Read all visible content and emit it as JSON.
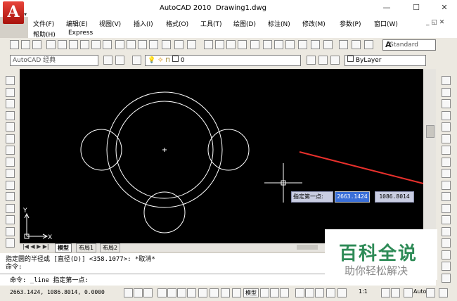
{
  "window": {
    "app_name": "AutoCAD 2010",
    "doc_name": "Drawing1.dwg",
    "logo_letter": "A",
    "controls": [
      "—",
      "☐",
      "✕"
    ],
    "mdi_controls": "_ ◱ ✕"
  },
  "menus": [
    "文件(F)",
    "编辑(E)",
    "视图(V)",
    "插入(I)",
    "格式(O)",
    "工具(T)",
    "绘图(D)",
    "标注(N)",
    "修改(M)",
    "参数(P)",
    "窗口(W)"
  ],
  "menus2": [
    "帮助(H)",
    "Express"
  ],
  "toolbar": {
    "workspace": "AutoCAD 经典",
    "layer_value": "0",
    "text_style": "Standard",
    "color_value": "ByLayer"
  },
  "canvas": {
    "tooltip_label": "指定第一点:",
    "coord_x": "2663.1424",
    "coord_y": "1086.8014",
    "ucs_x": "X",
    "ucs_y": "Y"
  },
  "tabs": [
    "模型",
    "布局1",
    "布局2"
  ],
  "command": {
    "line1": "指定圆的半径或 [直径(D)] <358.1077>: *取消*",
    "line2": "命令:",
    "line3": "命令:  _line 指定第一点:"
  },
  "status": {
    "coords": "2663.1424, 1086.8014, 0.0000",
    "model": "模型",
    "scale": "1:1",
    "auto": "Auto"
  },
  "watermark": {
    "title": "百科全说",
    "subtitle": "助你轻松解决"
  },
  "colors": {
    "canvas_bg": "#000000",
    "entity": "#ffffff",
    "arrow": "#e8302c",
    "brand_text": "#2e8b57"
  }
}
